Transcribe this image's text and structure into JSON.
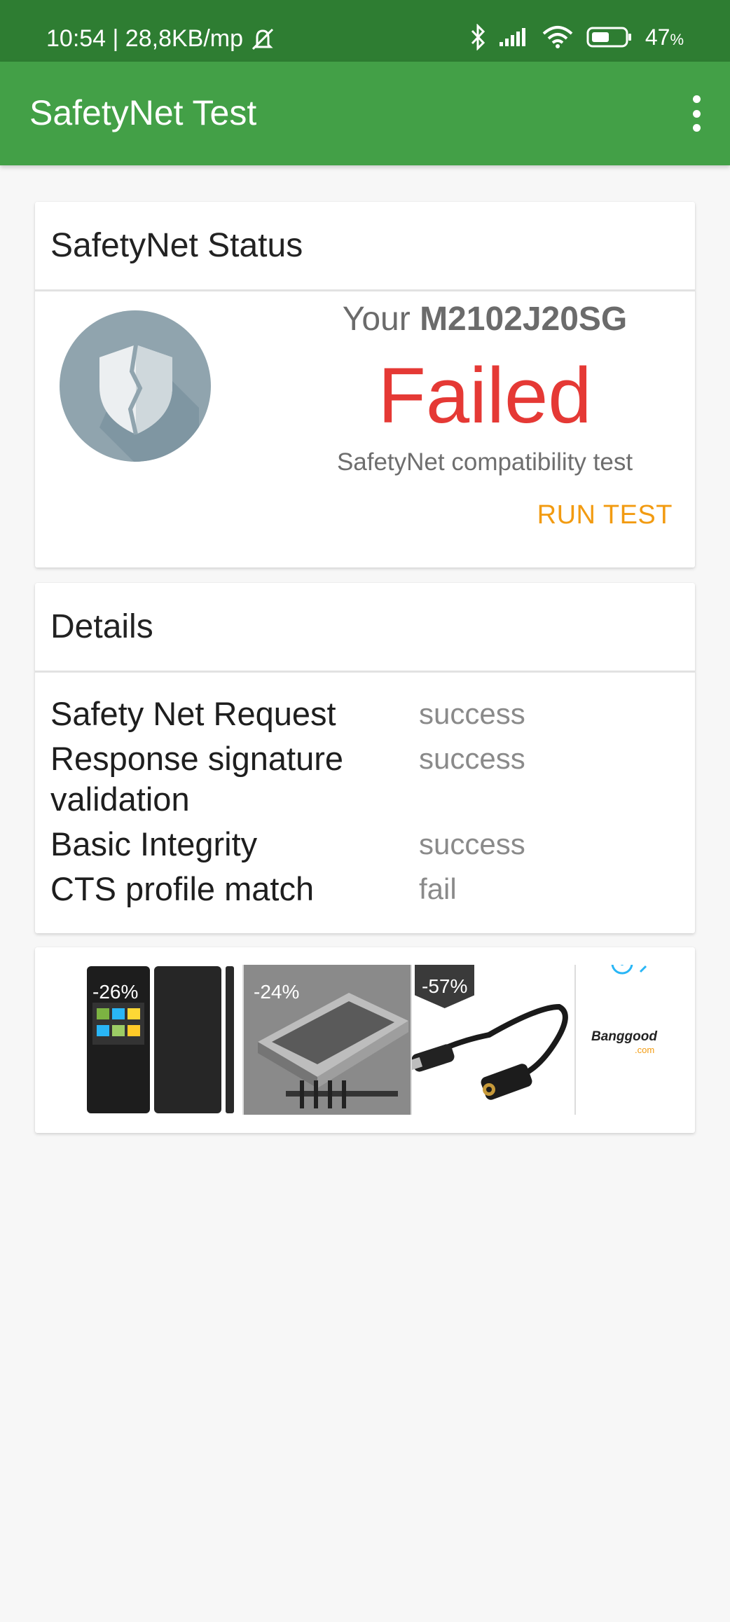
{
  "status_bar": {
    "time_info": "10:54 | 28,8KB/mp",
    "battery": "47",
    "battery_unit": "%"
  },
  "app_bar": {
    "title": "SafetyNet Test"
  },
  "status_card": {
    "title": "SafetyNet Status",
    "device_prefix": "Your",
    "device_model": "M2102J20SG",
    "result": "Failed",
    "result_color": "#e53935",
    "subtitle": "SafetyNet compatibility test",
    "run_test_label": "RUN TEST",
    "accent_color": "#f29b11"
  },
  "details_card": {
    "title": "Details",
    "rows": [
      {
        "label": "Safety Net Request",
        "value": "success"
      },
      {
        "label": "Response signature validation",
        "value": "success"
      },
      {
        "label": "Basic Integrity",
        "value": "success"
      },
      {
        "label": "CTS profile match",
        "value": "fail"
      }
    ]
  },
  "ad": {
    "items": [
      {
        "badge": "-26%"
      },
      {
        "badge": "-24%"
      },
      {
        "badge": "-57%"
      }
    ],
    "brand": "Banggood",
    "brand_suffix": ".com"
  },
  "colors": {
    "status_bar": "#2e7d32",
    "app_bar": "#43a047"
  }
}
